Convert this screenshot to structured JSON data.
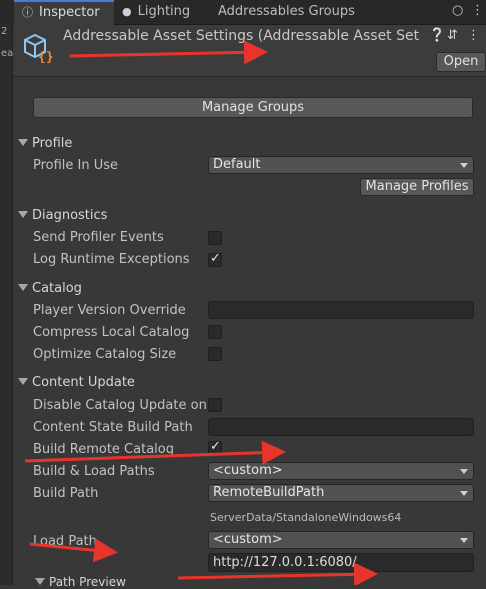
{
  "tabs": [
    {
      "label": "Inspector",
      "icon": "info-icon",
      "active": true
    },
    {
      "label": "Lighting",
      "icon": "lightbulb-icon",
      "active": false
    },
    {
      "label": "Addressables Groups",
      "icon": "",
      "active": false
    }
  ],
  "left_strip": {
    "top": "2",
    "bottom": "ea"
  },
  "header": {
    "title": "Addressable Asset Settings (Addressable Asset Set",
    "open_label": "Open"
  },
  "buttons": {
    "manage_groups": "Manage Groups",
    "manage_profiles": "Manage Profiles"
  },
  "sections": {
    "profile": "Profile",
    "diagnostics": "Diagnostics",
    "catalog": "Catalog",
    "content_update": "Content Update",
    "path_preview": "Path Preview"
  },
  "fields": {
    "profile_in_use": {
      "label": "Profile In Use",
      "value": "Default"
    },
    "send_profiler_events": {
      "label": "Send Profiler Events",
      "checked": false
    },
    "log_runtime_exceptions": {
      "label": "Log Runtime Exceptions",
      "checked": true
    },
    "player_version_override": {
      "label": "Player Version Override",
      "value": ""
    },
    "compress_local_catalog": {
      "label": "Compress Local Catalog",
      "checked": false
    },
    "optimize_catalog_size": {
      "label": "Optimize Catalog Size",
      "checked": false
    },
    "disable_catalog_update": {
      "label": "Disable Catalog Update on S",
      "checked": false
    },
    "content_state_build_path": {
      "label": "Content State Build Path",
      "value": ""
    },
    "build_remote_catalog": {
      "label": "Build Remote Catalog",
      "checked": true
    },
    "build_load_paths": {
      "label": "Build & Load Paths",
      "value": "<custom>"
    },
    "build_path": {
      "label": "Build Path",
      "value": "RemoteBuildPath",
      "hint": "ServerData/StandaloneWindows64"
    },
    "load_path": {
      "label": "Load Path",
      "value": "<custom>",
      "url": "http://127.0.0.1:6080/"
    }
  },
  "colors": {
    "accent": "#4b7bd6",
    "annotation": "#e8352b",
    "background": "#383838"
  }
}
